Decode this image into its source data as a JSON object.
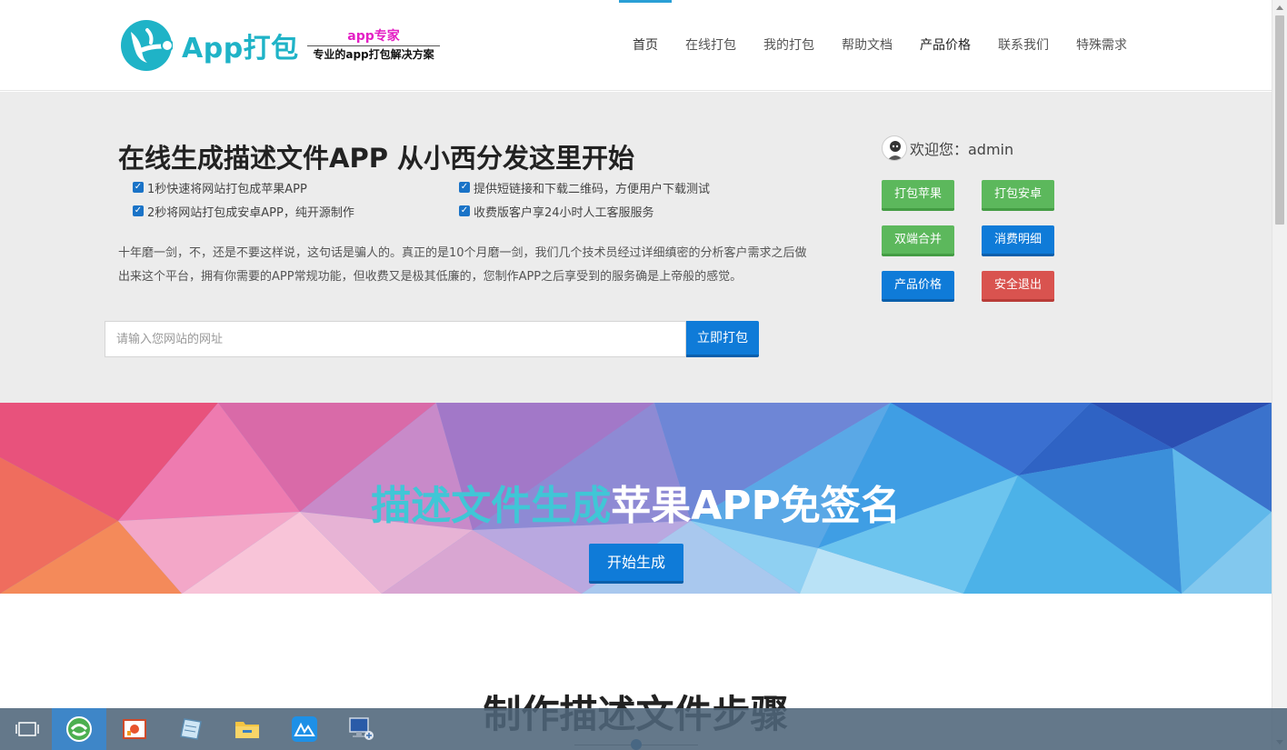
{
  "header": {
    "logo_text": "App打包",
    "slogan_top": "app专家",
    "slogan_bottom": "专业的app打包解决方案",
    "nav": [
      {
        "label": "首页"
      },
      {
        "label": "在线打包"
      },
      {
        "label": "我的打包"
      },
      {
        "label": "帮助文档"
      },
      {
        "label": "产品价格"
      },
      {
        "label": "联系我们"
      },
      {
        "label": "特殊需求"
      }
    ]
  },
  "hero": {
    "title": "在线生成描述文件APP 从小西分发这里开始",
    "features": [
      "1秒快速将网站打包成苹果APP",
      "提供短链接和下载二维码，方便用户下载测试",
      "2秒将网站打包成安卓APP，纯开源制作",
      "收费版客户享24小时人工客服服务"
    ],
    "description": "十年磨一剑，不，还是不要这样说，这句话是骗人的。真正的是10个月磨一剑，我们几个技术员经过详细缜密的分析客户需求之后做出来这个平台，拥有你需要的APP常规功能，但收费又是极其低廉的，您制作APP之后享受到的服务确是上帝般的感觉。",
    "url_placeholder": "请输入您网站的网址",
    "url_value": "",
    "pack_button": "立即打包"
  },
  "user_panel": {
    "welcome": "欢迎您：admin",
    "buttons": [
      {
        "label": "打包苹果"
      },
      {
        "label": "打包安卓"
      },
      {
        "label": "双端合并"
      },
      {
        "label": "消费明细"
      },
      {
        "label": "产品价格"
      },
      {
        "label": "安全退出"
      }
    ]
  },
  "banner": {
    "title_highlight": "描述文件生成",
    "title_rest": "苹果APP免签名",
    "start_button": "开始生成"
  },
  "section": {
    "title": "制作描述文件步骤"
  },
  "colors": {
    "accent_blue": "#0f7bd8",
    "green": "#5cb85c",
    "red": "#d9534f",
    "logo_teal": "#1fb3c7",
    "slogan_pink": "#e41ec4",
    "banner_highlight": "#40c6d6"
  },
  "taskbar": {
    "items": [
      {
        "icon": "task-view-icon"
      },
      {
        "icon": "browser-icon"
      },
      {
        "icon": "presentation-icon"
      },
      {
        "icon": "notes-icon"
      },
      {
        "icon": "file-explorer-icon"
      },
      {
        "icon": "photos-icon"
      },
      {
        "icon": "remote-desktop-icon"
      }
    ]
  }
}
